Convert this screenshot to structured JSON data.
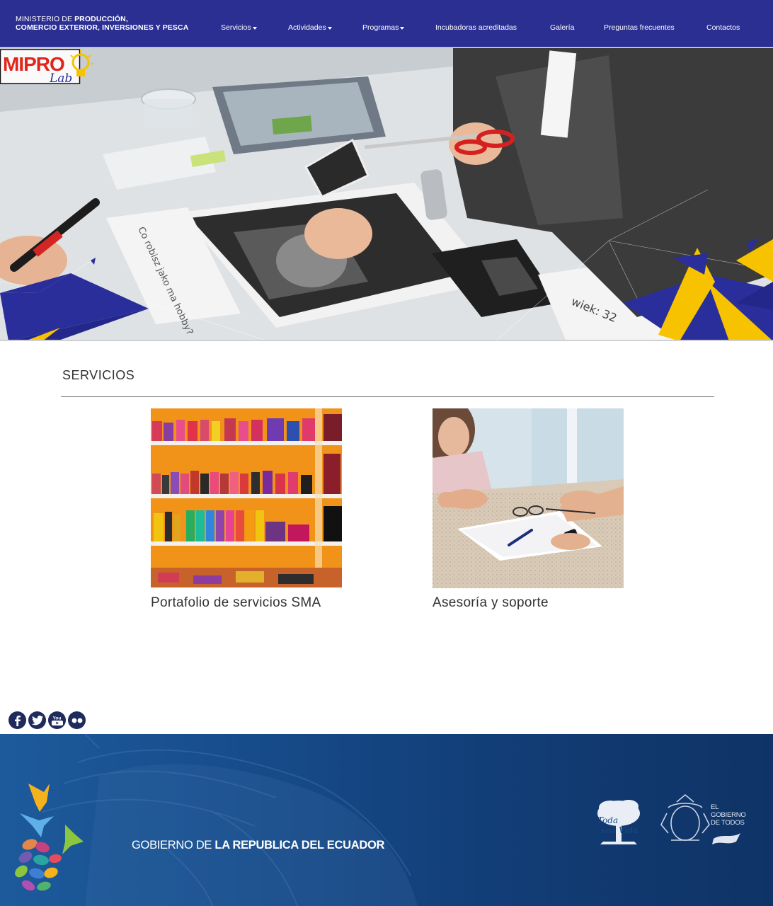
{
  "header": {
    "ministry_line1_light": "MINISTERIO DE ",
    "ministry_line1_bold": "PRODUCCIÓN,",
    "ministry_line2": "COMERCIO EXTERIOR, INVERSIONES Y PESCA",
    "nav": [
      {
        "label": "Servicios",
        "dropdown": true
      },
      {
        "label": "Actividades",
        "dropdown": true
      },
      {
        "label": "Programas",
        "dropdown": true
      },
      {
        "label": "Incubadoras acreditadas",
        "dropdown": false
      },
      {
        "label": "Galería",
        "dropdown": false
      },
      {
        "label": "Preguntas frecuentes",
        "dropdown": false
      },
      {
        "label": "Contactos",
        "dropdown": false
      }
    ]
  },
  "hero": {
    "logo_main": "MIPRO",
    "logo_sub": "Lab",
    "note_text": "Co robisz jako ma hobby?",
    "card_text": "wiek: 32"
  },
  "services": {
    "title": "SERVICIOS",
    "cards": [
      {
        "caption": "Portafolio de servicios SMA"
      },
      {
        "caption": "Asesoría y soporte"
      }
    ]
  },
  "social": [
    "facebook-icon",
    "twitter-icon",
    "youtube-icon",
    "flickr-icon"
  ],
  "social_youtube_label": "You",
  "footer": {
    "gov_light": "GOBIERNO DE ",
    "gov_bold": "LA REPUBLICA DEL ECUADOR",
    "toda_vida": [
      "Toda",
      "una",
      "Vida"
    ],
    "gobierno_todos": [
      "EL",
      "GOBIERNO",
      "DE TODOS"
    ]
  },
  "colors": {
    "nav_bg": "#2c2f92",
    "footer_bg": "#174d8c",
    "accent_yellow": "#f7c300",
    "accent_blue": "#2a2e9a",
    "logo_red": "#e1251b"
  }
}
